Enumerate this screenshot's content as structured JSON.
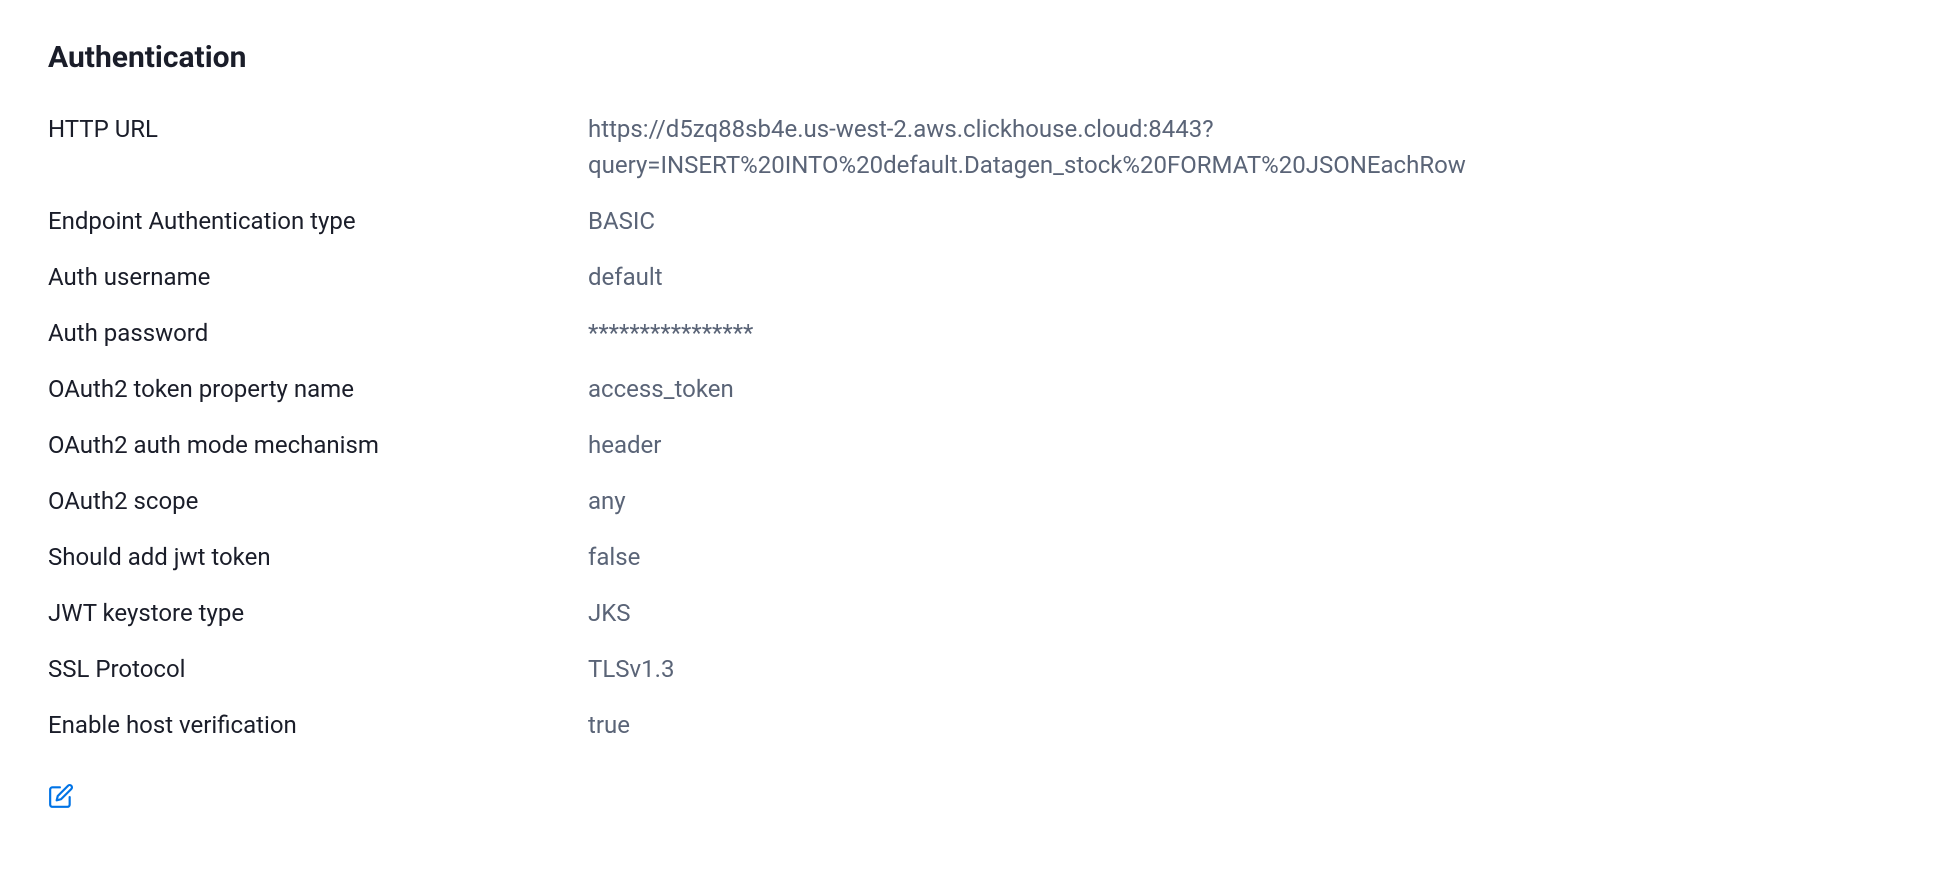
{
  "section": {
    "title": "Authentication"
  },
  "fields": {
    "http_url": {
      "label": "HTTP URL",
      "value": "https://d5zq88sb4e.us-west-2.aws.clickhouse.cloud:8443?query=INSERT%20INTO%20default.Datagen_stock%20FORMAT%20JSONEachRow"
    },
    "endpoint_auth_type": {
      "label": "Endpoint Authentication type",
      "value": "BASIC"
    },
    "auth_username": {
      "label": "Auth username",
      "value": "default"
    },
    "auth_password": {
      "label": "Auth password",
      "value": "****************"
    },
    "oauth2_token_property": {
      "label": "OAuth2 token property name",
      "value": "access_token"
    },
    "oauth2_auth_mode": {
      "label": "OAuth2 auth mode mechanism",
      "value": "header"
    },
    "oauth2_scope": {
      "label": "OAuth2 scope",
      "value": "any"
    },
    "should_add_jwt": {
      "label": "Should add jwt token",
      "value": "false"
    },
    "jwt_keystore_type": {
      "label": "JWT keystore type",
      "value": "JKS"
    },
    "ssl_protocol": {
      "label": "SSL Protocol",
      "value": "TLSv1.3"
    },
    "enable_host_verification": {
      "label": "Enable host verification",
      "value": "true"
    }
  }
}
